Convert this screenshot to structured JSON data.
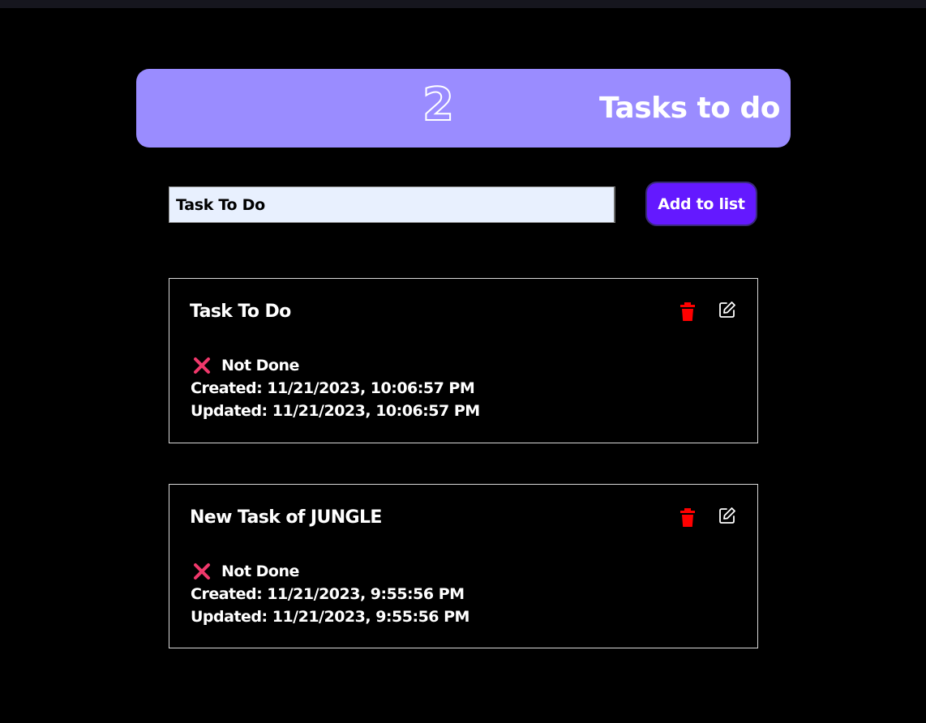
{
  "header": {
    "count": "2",
    "title": "Tasks to do"
  },
  "form": {
    "input_value": "Task To Do",
    "add_button_label": "Add to list"
  },
  "tasks": [
    {
      "title": "Task To Do",
      "status": "Not Done",
      "created": "Created: 11/21/2023, 10:06:57 PM",
      "updated": "Updated: 11/21/2023, 10:06:57 PM"
    },
    {
      "title": "New Task of JUNGLE",
      "status": "Not Done",
      "created": "Created: 11/21/2023, 9:55:56 PM",
      "updated": "Updated: 11/21/2023, 9:55:56 PM"
    }
  ],
  "icons": {
    "status": "close-x-icon",
    "delete": "trash-icon",
    "edit": "edit-icon"
  },
  "colors": {
    "header_bg": "#9a8cff",
    "button_bg": "#6419ff",
    "delete_red": "#ff0000",
    "status_x": "#f0386b"
  }
}
